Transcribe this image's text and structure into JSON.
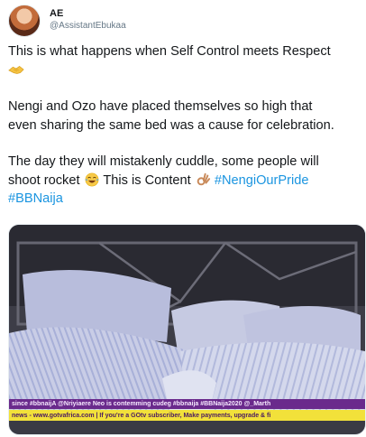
{
  "tweet": {
    "author_name": "AE",
    "author_handle": "@AssistantEbukaa",
    "para1": "This is what happens when Self Control meets Respect",
    "para2_line1": "Nengi and Ozo have placed themselves so high that",
    "para2_line2": "even sharing the same bed was a cause for celebration.",
    "para3_line1": "The day they will mistakenly cuddle, some people will",
    "para3_text_a": "shoot rocket",
    "para3_text_b": "This is Content",
    "hashtag1": "#NengiOurPride",
    "hashtag2": "#BBNaija"
  },
  "media": {
    "ticker_line1": "since #bbnaijA   @Nriyiaere Neo is contemming cudeg #bbnaija #BBNaija2020   @_Marth",
    "ticker_line2": "news - www.gotvafrica.com  |  If you're a GOtv subscriber, Make payments, upgrade & fi"
  },
  "icons": {
    "emoji1": "handshake-emoji",
    "emoji2": "tears-of-joy-emoji",
    "emoji3": "ok-hand-emoji"
  },
  "colors": {
    "link": "#1b95e0",
    "ticker_bar": "#6a2a8c"
  }
}
